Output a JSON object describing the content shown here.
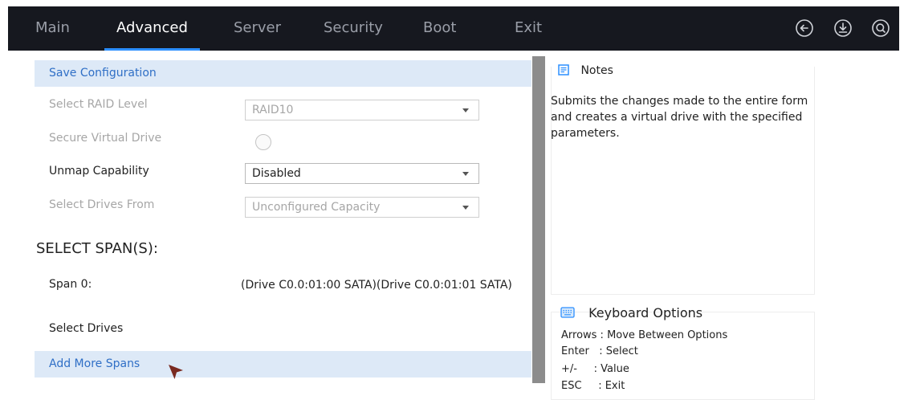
{
  "nav": {
    "tabs": [
      {
        "label": "Main",
        "active": false
      },
      {
        "label": "Advanced",
        "active": true
      },
      {
        "label": "Server",
        "active": false
      },
      {
        "label": "Security",
        "active": false
      },
      {
        "label": "Boot",
        "active": false
      },
      {
        "label": "Exit",
        "active": false
      }
    ],
    "icons": [
      "back-arrow-icon",
      "save-download-icon",
      "search-icon"
    ]
  },
  "form": {
    "save_configuration": "Save Configuration",
    "raid_level": {
      "label": "Select RAID Level",
      "value": "RAID10"
    },
    "secure_vd": {
      "label": "Secure Virtual Drive",
      "checked": false
    },
    "unmap": {
      "label": "Unmap Capability",
      "value": "Disabled"
    },
    "drives_from": {
      "label": "Select Drives From",
      "value": "Unconfigured Capacity"
    },
    "select_spans_title": "SELECT SPAN(S):",
    "span0": {
      "label": "Span 0:",
      "value": "(Drive C0.0:01:00 SATA)(Drive C0.0:01:01 SATA)"
    },
    "select_drives": "Select Drives",
    "add_more_spans": "Add More Spans"
  },
  "notes": {
    "title": "Notes",
    "body": "Submits the changes made to the entire form and creates a virtual drive with the specified parameters."
  },
  "keyboard": {
    "title": "Keyboard Options",
    "lines": [
      "Arrows : Move Between Options",
      "Enter   : Select",
      "+/-     : Value",
      "ESC     : Exit"
    ]
  },
  "colors": {
    "topbar": "#16181f",
    "active_underline": "#2c8fff",
    "strip_bg": "#dde9f7",
    "strip_text": "#2f6fc6",
    "disabled_text": "#a6a6a6"
  }
}
